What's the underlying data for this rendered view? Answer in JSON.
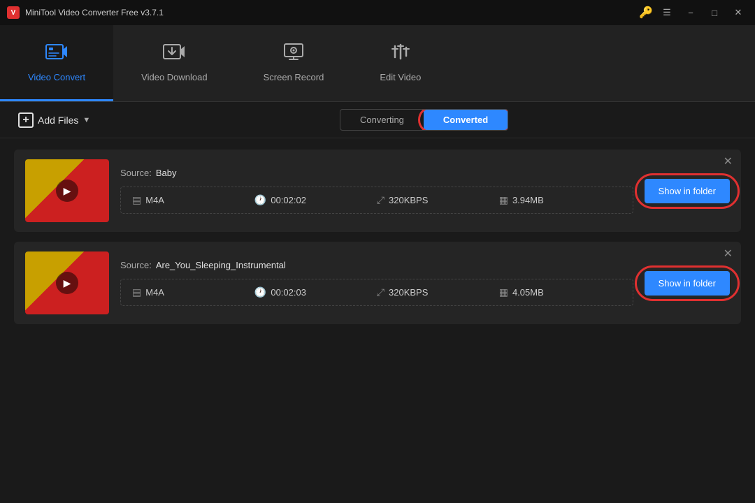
{
  "titleBar": {
    "appName": "MiniTool Video Converter Free v3.7.1",
    "minimizeLabel": "−",
    "maximizeLabel": "□",
    "closeLabel": "✕"
  },
  "nav": {
    "items": [
      {
        "id": "video-convert",
        "label": "Video Convert",
        "icon": "⬛",
        "active": true
      },
      {
        "id": "video-download",
        "label": "Video Download",
        "icon": "⬛",
        "active": false
      },
      {
        "id": "screen-record",
        "label": "Screen Record",
        "icon": "⬛",
        "active": false
      },
      {
        "id": "edit-video",
        "label": "Edit Video",
        "icon": "⬛",
        "active": false
      }
    ]
  },
  "toolbar": {
    "addFilesLabel": "Add Files",
    "tabs": [
      {
        "id": "converting",
        "label": "Converting",
        "active": false
      },
      {
        "id": "converted",
        "label": "Converted",
        "active": true
      }
    ]
  },
  "files": [
    {
      "id": "file-1",
      "sourceName": "Baby",
      "format": "M4A",
      "duration": "00:02:02",
      "bitrate": "320KBPS",
      "size": "3.94MB",
      "showFolderLabel": "Show in folder"
    },
    {
      "id": "file-2",
      "sourceName": "Are_You_Sleeping_Instrumental",
      "format": "M4A",
      "duration": "00:02:03",
      "bitrate": "320KBPS",
      "size": "4.05MB",
      "showFolderLabel": "Show in folder"
    }
  ],
  "labels": {
    "sourcePrefix": "Source:",
    "sourceLabel": "Source"
  }
}
